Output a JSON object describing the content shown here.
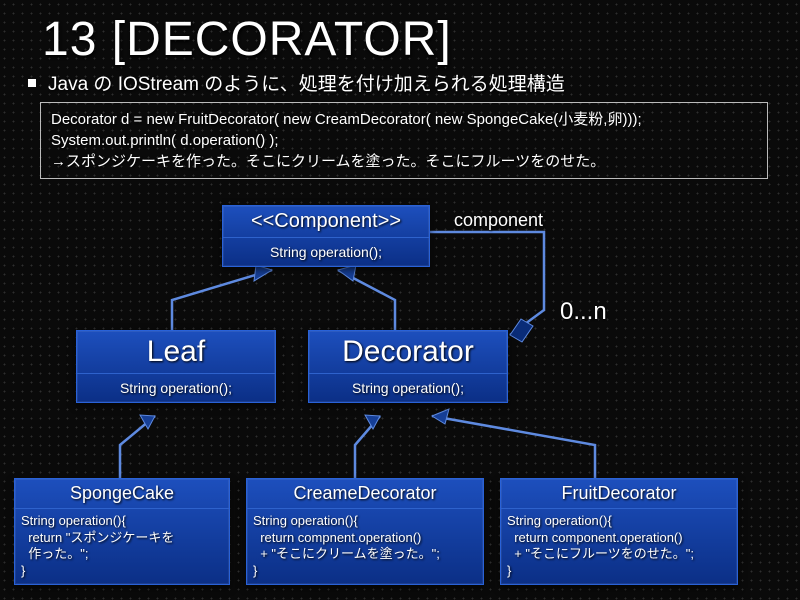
{
  "title": "13 [DECORATOR]",
  "subtitle": "Java の IOStream のように、処理を付け加えられる処理構造",
  "code": {
    "line1": "Decorator d = new FruitDecorator( new CreamDecorator( new SpongeCake(小麦粉,卵)));",
    "line2": "System.out.println( d.operation() );",
    "line3": "→スポンジケーキを作った。そこにクリームを塗った。そこにフルーツをのせた。"
  },
  "labels": {
    "component": "component",
    "multiplicity": "0...n"
  },
  "classes": {
    "component": {
      "name": "<<Component>>",
      "op": "String operation();"
    },
    "leaf": {
      "name": "Leaf",
      "op": "String operation();"
    },
    "decorator": {
      "name": "Decorator",
      "op": "String operation();"
    },
    "sponge": {
      "name": "SpongeCake",
      "body": "String operation(){\n  return \"スポンジケーキを\n  作った。\";\n}"
    },
    "cream": {
      "name": "CreameDecorator",
      "body": "String operation(){\n  return compnent.operation()\n  + \"そこにクリームを塗った。\";\n}"
    },
    "fruit": {
      "name": "FruitDecorator",
      "body": "String operation(){\n  return component.operation()\n  + \"そこにフルーツをのせた。\";\n}"
    }
  }
}
